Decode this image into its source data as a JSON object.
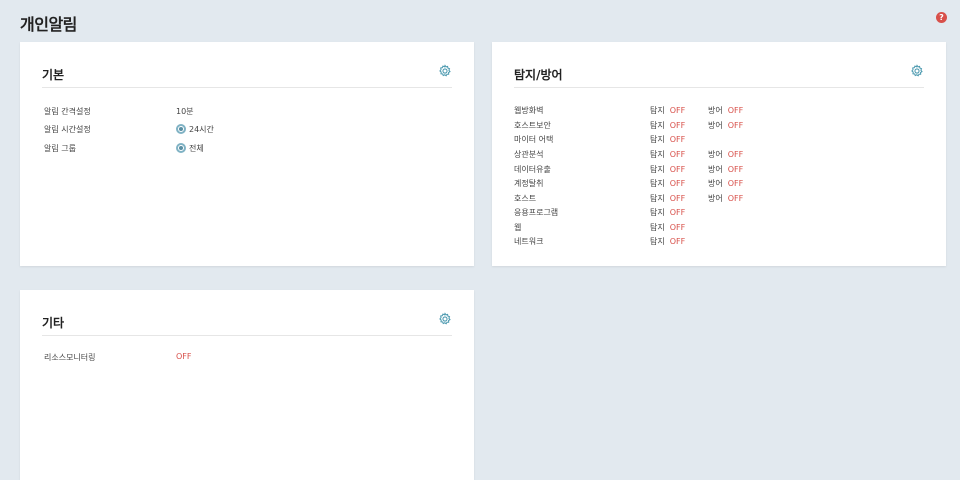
{
  "page": {
    "title": "개인알림",
    "help_icon": "question-circle-icon"
  },
  "colors": {
    "background": "#e2e9ef",
    "off": "#d8504a",
    "accent": "#5a8fa3"
  },
  "basic": {
    "title": "기본",
    "rows": [
      {
        "label": "알림 간격설정",
        "value": "10분"
      },
      {
        "label": "알림 시간설정",
        "value": "24시간"
      },
      {
        "label": "알림 그룹",
        "value": "전체"
      }
    ]
  },
  "detection": {
    "title": "탐지/방어",
    "detect_label": "탐지",
    "defense_label": "방어",
    "rows": [
      {
        "name": "웹방화벽",
        "detect": "OFF",
        "defense": "OFF"
      },
      {
        "name": "호스트보안",
        "detect": "OFF",
        "defense": "OFF"
      },
      {
        "name": "마이터 어택",
        "detect": "OFF"
      },
      {
        "name": "상관분석",
        "detect": "OFF",
        "defense": "OFF"
      },
      {
        "name": "데이터유출",
        "detect": "OFF",
        "defense": "OFF"
      },
      {
        "name": "계정탈취",
        "detect": "OFF",
        "defense": "OFF"
      },
      {
        "name": "호스트",
        "detect": "OFF",
        "defense": "OFF"
      },
      {
        "name": "응용프로그램",
        "detect": "OFF"
      },
      {
        "name": "웹",
        "detect": "OFF"
      },
      {
        "name": "네트워크",
        "detect": "OFF"
      }
    ]
  },
  "etc": {
    "title": "기타",
    "rows": [
      {
        "label": "리소스모니터링",
        "value": "OFF"
      }
    ]
  }
}
